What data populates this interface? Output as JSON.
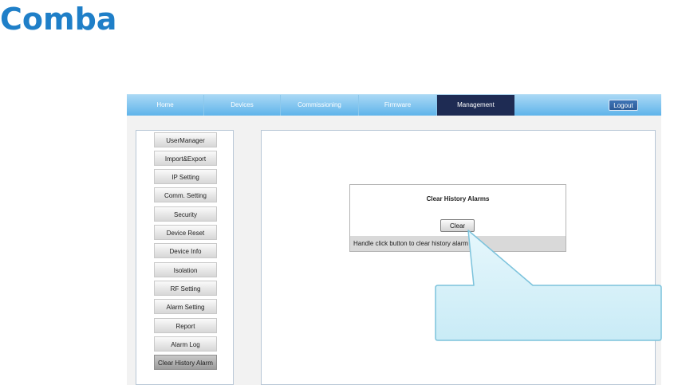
{
  "brand": {
    "logo_text": "Comba"
  },
  "nav": {
    "tabs": [
      {
        "label": "Home"
      },
      {
        "label": "Devices"
      },
      {
        "label": "Commissioning"
      },
      {
        "label": "Firmware"
      },
      {
        "label": "Management"
      }
    ],
    "active_tab": "Management",
    "logout_label": "Logout"
  },
  "sidebar": {
    "items": [
      {
        "label": "UserManager"
      },
      {
        "label": "Import&Export"
      },
      {
        "label": "IP Setting"
      },
      {
        "label": "Comm. Setting"
      },
      {
        "label": "Security"
      },
      {
        "label": "Device Reset"
      },
      {
        "label": "Device Info"
      },
      {
        "label": "Isolation"
      },
      {
        "label": "RF Setting"
      },
      {
        "label": "Alarm Setting"
      },
      {
        "label": "Report"
      },
      {
        "label": "Alarm Log"
      },
      {
        "label": "Clear History Alarm"
      }
    ],
    "active_item": "Clear History Alarm"
  },
  "panel": {
    "title": "Clear History Alarms",
    "clear_label": "Clear",
    "footer_text": "Handle click button to clear history alarm"
  },
  "colors": {
    "brand": "#1f7fc8",
    "nav_active": "#1e2b53",
    "callout_fill": "#d6f0f8",
    "callout_border": "#7cc3dc"
  }
}
